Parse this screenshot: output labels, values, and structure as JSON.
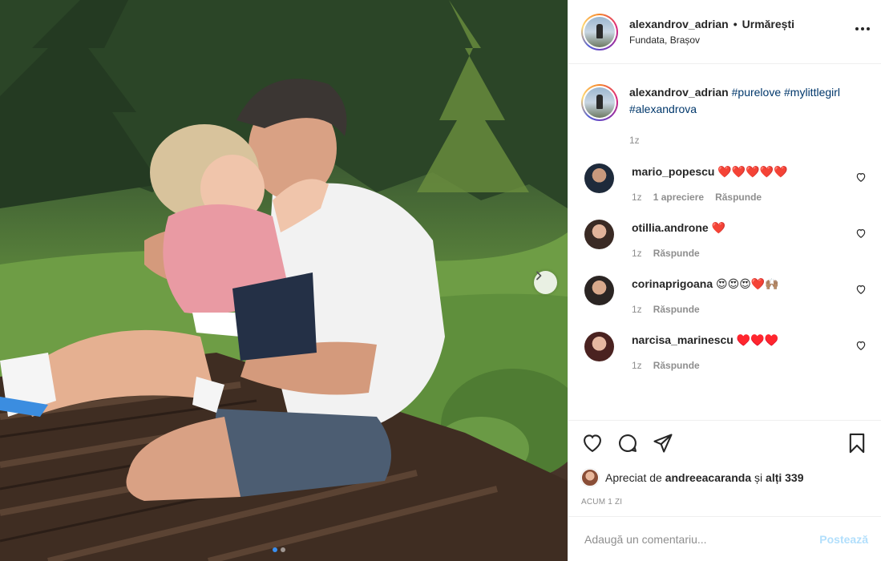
{
  "post": {
    "username": "alexandrov_adrian",
    "follow_separator": "•",
    "follow_label": "Urmărești",
    "location": "Fundata, Brașov"
  },
  "caption": {
    "username": "alexandrov_adrian",
    "tag1": "#purelove",
    "tag2": "#mylittlegirl",
    "tag3": "#alexandrova",
    "time": "1z"
  },
  "comments": [
    {
      "username": "mario_popescu",
      "text": "❤️❤️❤️❤️❤️",
      "time": "1z",
      "likes": "1 apreciere",
      "reply": "Răspunde"
    },
    {
      "username": "otillia.androne",
      "text": "❤️",
      "time": "1z",
      "reply": "Răspunde"
    },
    {
      "username": "corinaprigoana",
      "text": "😍😍😍❤️🙌🏽",
      "time": "1z",
      "reply": "Răspunde"
    },
    {
      "username": "narcisa_marinescu",
      "text": "♥️♥️♥️",
      "time": "1z",
      "reply": "Răspunde"
    }
  ],
  "likes": {
    "prefix": "Apreciat de",
    "user": "andreeacaranda",
    "connector": "și",
    "others": "alți 339"
  },
  "timestamp": "ACUM 1 ZI",
  "add_comment": {
    "placeholder": "Adaugă un comentariu...",
    "post_label": "Postează"
  },
  "carousel": {
    "current": 1,
    "total": 2
  },
  "colors": {
    "hashtag": "#00376b",
    "secondary_text": "#8e8e8e",
    "post_button_disabled": "#b2dffc",
    "carousel_active_dot": "#3a8ff0"
  },
  "icons": [
    "more-options-icon",
    "heart-icon",
    "comment-icon",
    "share-icon",
    "bookmark-icon",
    "chevron-right-icon"
  ]
}
